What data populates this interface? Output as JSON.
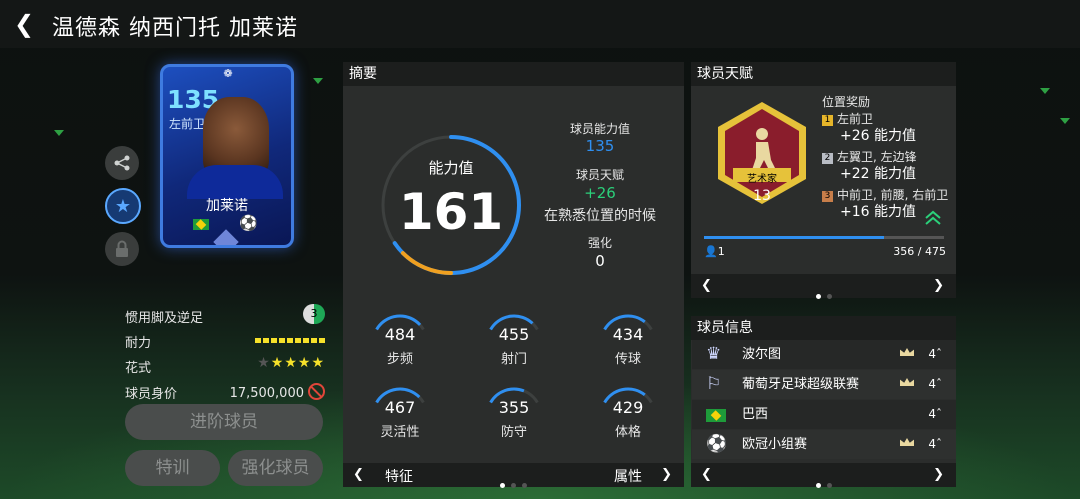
{
  "header": {
    "back_icon": "chevron-left-icon",
    "title": "温德森 纳西门托 加莱诺"
  },
  "card": {
    "rating": "135",
    "position": "左前卫",
    "name": "加莱诺",
    "flag": "brazil-flag-icon",
    "competition": "champions-league-icon"
  },
  "side_actions": [
    {
      "icon": "share-icon"
    },
    {
      "icon": "star-icon",
      "active": true
    },
    {
      "icon": "lock-icon"
    }
  ],
  "player_stats": {
    "weak_foot_label": "惯用脚及逆足",
    "weak_foot_value": "3",
    "stamina_label": "耐力",
    "skills_label": "花式",
    "skills_stars": 4,
    "skills_max": 5,
    "value_label": "球员身价",
    "value": "17,500,000"
  },
  "buttons": {
    "upgrade": "进阶球员",
    "train": "特训",
    "enhance": "强化球员"
  },
  "summary": {
    "title": "摘要",
    "gauge_label": "能力值",
    "gauge_value": "161",
    "gauge_fill": 0.84,
    "player_ovr_label": "球员能力值",
    "player_ovr_value": "135",
    "talent_label": "球员天赋",
    "talent_value": "+26",
    "talent_note": "在熟悉位置的时候",
    "boost_label": "强化",
    "boost_value": "0",
    "attributes": [
      {
        "value": "484",
        "label": "步频",
        "fill": 0.45
      },
      {
        "value": "455",
        "label": "射门",
        "fill": 0.43
      },
      {
        "value": "434",
        "label": "传球",
        "fill": 0.41
      },
      {
        "value": "467",
        "label": "灵活性",
        "fill": 0.44
      },
      {
        "value": "355",
        "label": "防守",
        "fill": 0.34
      },
      {
        "value": "429",
        "label": "体格",
        "fill": 0.41
      }
    ],
    "footer_left": "特征",
    "footer_right": "属性"
  },
  "talent": {
    "title": "球员天赋",
    "badge_name": "艺术家",
    "badge_level": "13",
    "bonus_title": "位置奖励",
    "bonuses": [
      {
        "rank": "1",
        "positions": "左前卫",
        "value": "+26 能力值",
        "color": "#e6b52a"
      },
      {
        "rank": "2",
        "positions": "左翼卫, 左边锋",
        "value": "+22 能力值",
        "color": "#b8bcc4"
      },
      {
        "rank": "3",
        "positions": "中前卫, 前腰, 右前卫",
        "value": "+16 能力值",
        "color": "#c77e4a"
      }
    ],
    "progress_count": "1",
    "progress_text": "356 / 475",
    "progress_fraction": 0.75
  },
  "info": {
    "title": "球员信息",
    "rows": [
      {
        "icon": "porto-crest-icon",
        "name": "波尔图",
        "level": "4",
        "crown": true
      },
      {
        "icon": "liga-portugal-icon",
        "name": "葡萄牙足球超级联赛",
        "level": "4",
        "crown": true
      },
      {
        "icon": "brazil-flag-icon",
        "name": "巴西",
        "level": "4",
        "crown": false
      },
      {
        "icon": "champions-league-icon",
        "name": "欧冠小组赛",
        "level": "4",
        "crown": true
      }
    ]
  },
  "colors": {
    "accent_blue": "#2f8ff0",
    "gauge_orange": "#f0a020",
    "green": "#2bd07a",
    "gold": "#f6e12a"
  }
}
